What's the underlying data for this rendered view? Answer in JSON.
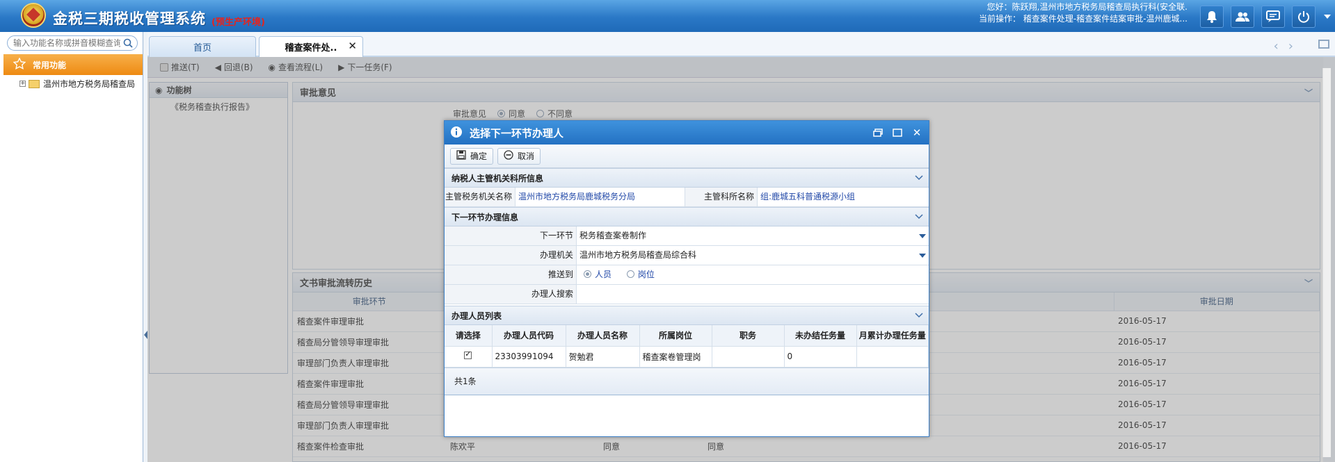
{
  "header": {
    "title": "金税三期税收管理系统",
    "env": "(预生产环境)",
    "greeting": "您好：陈跃翔,温州市地方税务局稽查局执行科(安全联.",
    "current_op": "当前操作： 稽查案件处理-稽查案件结案审批-温州鹿城..."
  },
  "sidebar": {
    "search_placeholder": "输入功能名称或拼音模糊查询",
    "menu_label": "常用功能",
    "tree_root": "温州市地方税务局稽查局"
  },
  "tabs": [
    {
      "label": "首页"
    },
    {
      "label": "稽查案件处.."
    }
  ],
  "page": {
    "toolbar": [
      "推送(T)",
      "回退(B)",
      "查看流程(L)",
      "下一任务(F)"
    ],
    "func_tree_title": "功能树",
    "func_tree_item": "《税务稽查执行报告》",
    "opinion_panel": "审批意见",
    "opinion_label": "审批意见",
    "opinion_yes": "同意",
    "opinion_no": "不同意",
    "history_panel": "文书审批流转历史",
    "history_cols": [
      "审批环节",
      "",
      "",
      "",
      "审批日期"
    ],
    "history_rows": [
      [
        "稽查案件审理审批",
        "",
        "",
        "",
        "2016-05-17"
      ],
      [
        "稽查局分管领导审理审批",
        "",
        "",
        "",
        "2016-05-17"
      ],
      [
        "审理部门负责人审理审批",
        "",
        "",
        "",
        "2016-05-17"
      ],
      [
        "稽查案件审理审批",
        "",
        "",
        "",
        "2016-05-17"
      ],
      [
        "稽查局分管领导审理审批",
        "",
        "",
        "",
        "2016-05-17"
      ],
      [
        "审理部门负责人审理审批",
        "",
        "",
        "",
        "2016-05-17"
      ],
      [
        "稽查案件检查审批",
        "陈欢平",
        "同意",
        "同意",
        "2016-05-17"
      ]
    ]
  },
  "modal": {
    "title": "选择下一环节办理人",
    "confirm": "确定",
    "cancel": "取消",
    "sec_taxpayer": "纳税人主管机关科所信息",
    "tax_office_label": "主管税务机关名称",
    "tax_office_value": "温州市地方税务局鹿城税务分局",
    "section_label": "主管科所名称",
    "section_value": "组:鹿城五科普通税源小组",
    "sec_next": "下一环节办理信息",
    "next_step_label": "下一环节",
    "next_step_value": "税务稽查案卷制作",
    "agency_label": "办理机关",
    "agency_value": "温州市地方税务局稽查局综合科",
    "push_label": "推送到",
    "push_person": "人员",
    "push_post": "岗位",
    "search_label": "办理人搜索",
    "search_value": "",
    "list_title": "办理人员列表",
    "list_cols": [
      "请选择",
      "办理人员代码",
      "办理人员名称",
      "所属岗位",
      "职务",
      "未办结任务量",
      "月累计办理任务量"
    ],
    "list_row": {
      "code": "23303991094",
      "name": "贺勉君",
      "post": "稽查案卷管理岗",
      "duty": "",
      "pending": "0",
      "monthly": ""
    },
    "total": "共1条"
  }
}
